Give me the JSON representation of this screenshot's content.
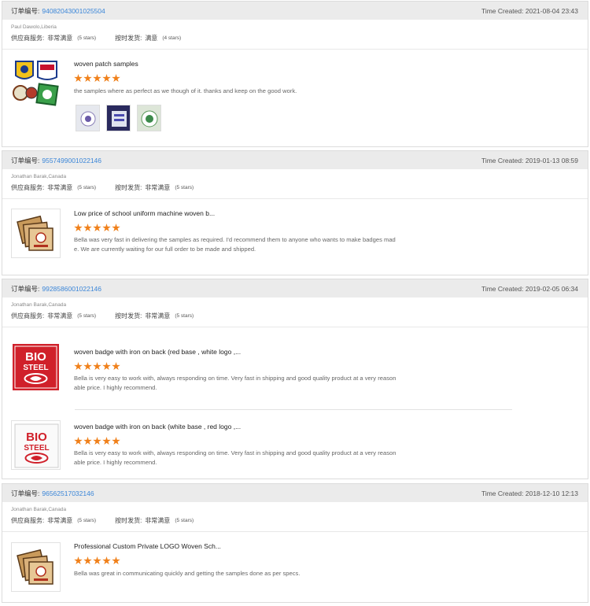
{
  "labels": {
    "order": "订单编号:",
    "time_prefix": "Time Created:",
    "supplier": "供应商服务:",
    "shipping": "按时发货:"
  },
  "reviews": [
    {
      "order_number": "94082043001025504",
      "time_created": "2021-08-04 23:43",
      "buyer": "Paul Dawolo,Liberia",
      "supplier_rating": "非常满意",
      "supplier_stars": "(5 stars)",
      "shipping_rating": "满意",
      "shipping_stars": "(4 stars)",
      "items": [
        {
          "title": "woven patch samples",
          "stars": 5,
          "text": "the samples where as perfect as we though of it. thanks and keep on the good work.",
          "photo_count": 3
        }
      ]
    },
    {
      "order_number": "95574990010221​46",
      "time_created": "2019-01-13 08:59",
      "buyer": "Jonathan Barak,Canada",
      "supplier_rating": "非常满意",
      "supplier_stars": "(5 stars)",
      "shipping_rating": "非常满意",
      "shipping_stars": "(5 stars)",
      "items": [
        {
          "title": "Low price of school uniform machine woven b...",
          "stars": 5,
          "text": "Bella was very fast in delivering the samples as required. I'd recommend them to anyone who wants to make badges made. We are currently waiting for our full order to be made and shipped."
        }
      ]
    },
    {
      "order_number": "99285860010221​46",
      "time_created": "2019-02-05 06:34",
      "buyer": "Jonathan Barak,Canada",
      "supplier_rating": "非常满意",
      "supplier_stars": "(5 stars)",
      "shipping_rating": "非常满意",
      "shipping_stars": "(5 stars)",
      "items": [
        {
          "title": "woven badge with iron on back (red base , white logo ,...",
          "stars": 5,
          "text": "Bella is very easy to work with, always responding on time. Very fast in shipping and good quality product at a very reasonable price. I highly recommend."
        },
        {
          "title": "woven badge with iron on back (white base , red logo ,...",
          "stars": 5,
          "text": "Bella is very easy to work with, always responding on time. Very fast in shipping and good quality product at a very reasonable price. I highly recommend."
        }
      ]
    },
    {
      "order_number": "96562517032146",
      "time_created": "2018-12-10 12:13",
      "buyer": "Jonathan Barak,Canada",
      "supplier_rating": "非常满意",
      "supplier_stars": "(5 stars)",
      "shipping_rating": "非常满意",
      "shipping_stars": "(5 stars)",
      "items": [
        {
          "title": "Professional Custom Private LOGO Woven Sch...",
          "stars": 5,
          "text": "Bella was great in communicating quickly and getting the samples done as per specs."
        }
      ]
    }
  ],
  "thumb_text": {
    "bio": "BIO",
    "steel": "STEEL"
  },
  "colors": {
    "accent_star": "#f0801a",
    "order_link": "#3b86d8",
    "header_bg": "#ebebeb",
    "bio_red": "#d0202a"
  }
}
